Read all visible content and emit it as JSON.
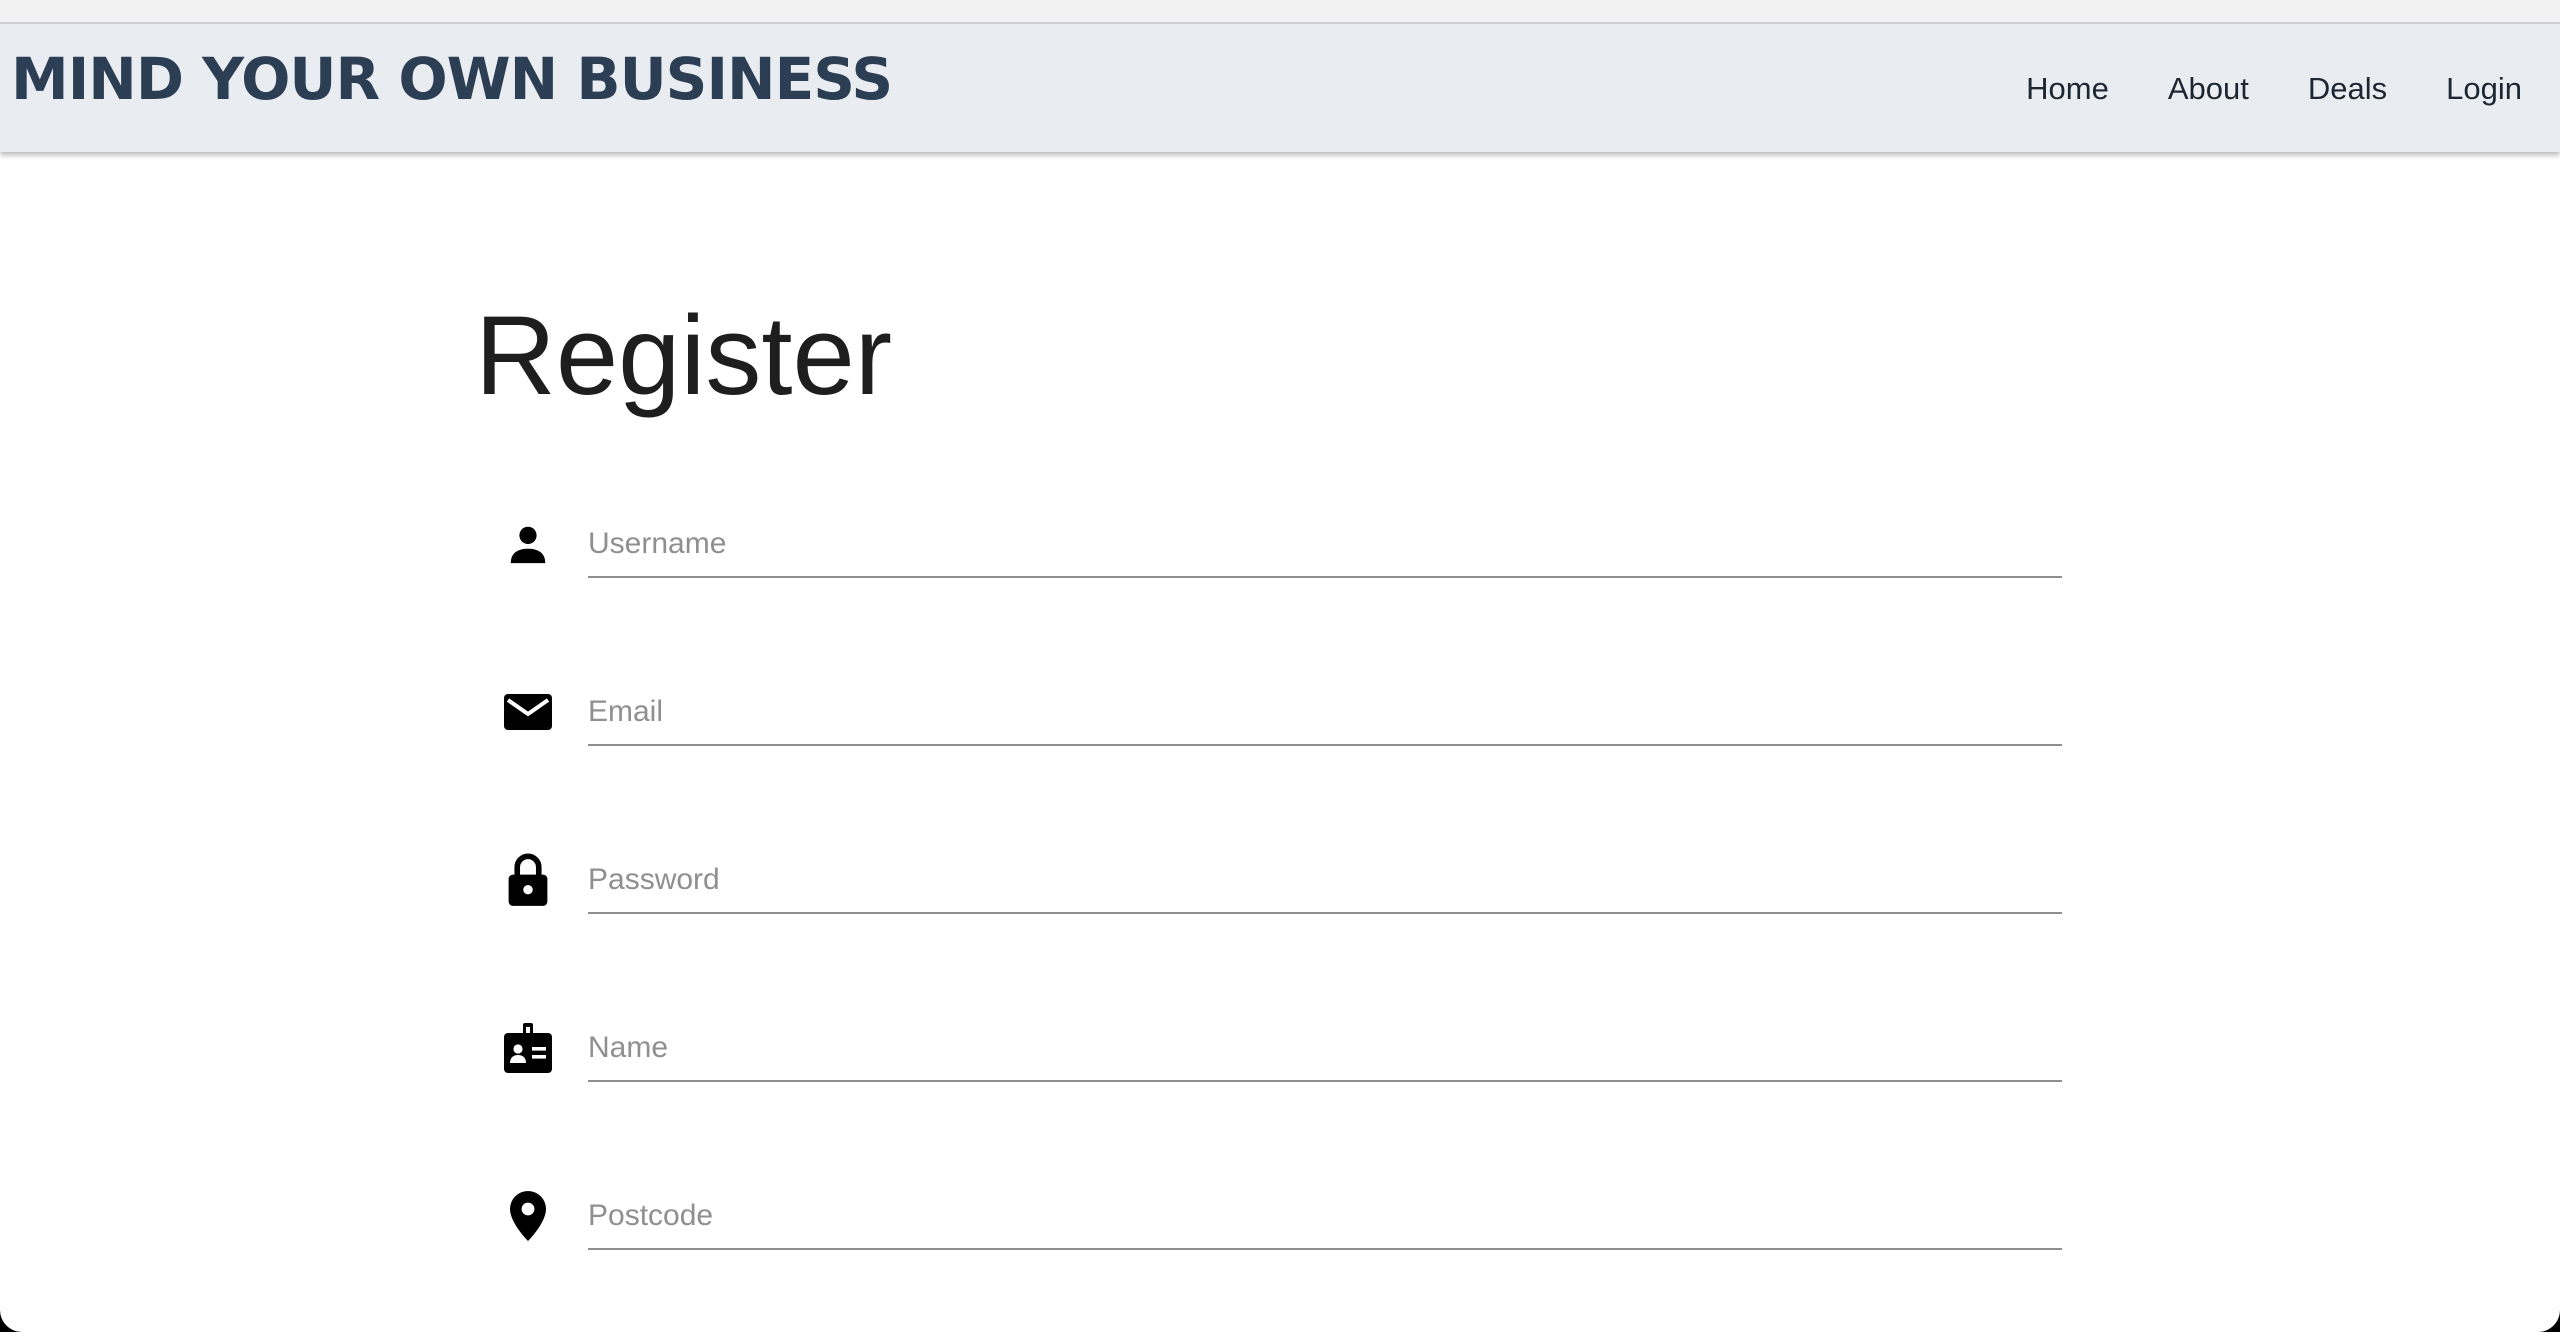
{
  "header": {
    "brand": "MIND YOUR OWN BUSINESS",
    "nav": [
      {
        "label": "Home"
      },
      {
        "label": "About"
      },
      {
        "label": "Deals"
      },
      {
        "label": "Login"
      }
    ]
  },
  "page": {
    "title": "Register"
  },
  "form": {
    "fields": [
      {
        "icon": "person-icon",
        "placeholder": "Username",
        "value": ""
      },
      {
        "icon": "envelope-icon",
        "placeholder": "Email",
        "value": ""
      },
      {
        "icon": "lock-icon",
        "placeholder": "Password",
        "value": ""
      },
      {
        "icon": "id-badge-icon",
        "placeholder": "Name",
        "value": ""
      },
      {
        "icon": "location-pin-icon",
        "placeholder": "Postcode",
        "value": ""
      }
    ]
  },
  "colors": {
    "navbar_bg": "#e9edf1",
    "brand": "#2c3e54",
    "nav_text": "#1d2733",
    "title": "#1e1e1e",
    "placeholder": "#8f8f8f",
    "underline": "#8e8e8e"
  }
}
